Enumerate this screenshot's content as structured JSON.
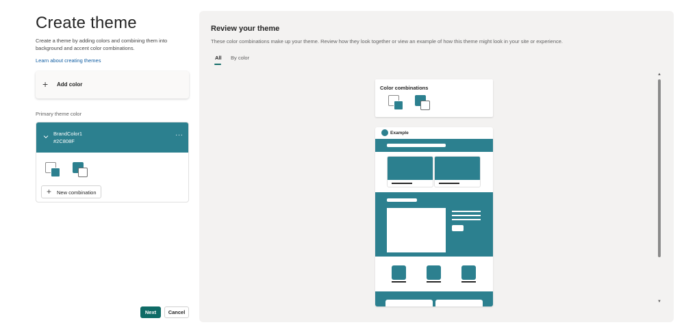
{
  "left": {
    "title": "Create theme",
    "description": "Create a theme by adding colors and combining them into background and accent color combinations.",
    "learn_link": "Learn about creating themes",
    "add_color_label": "Add color",
    "primary_label": "Primary theme color",
    "brand": {
      "name": "BrandColor1",
      "hex": "#2C808F"
    },
    "new_combination_label": "New combination"
  },
  "footer": {
    "next_label": "Next",
    "cancel_label": "Cancel"
  },
  "right": {
    "title": "Review your theme",
    "description": "These color combinations make up your theme. Review how they look together or view an example of how this theme might look in your site or experience.",
    "tabs": [
      {
        "label": "All",
        "selected": true
      },
      {
        "label": "By color",
        "selected": false
      }
    ],
    "color_combinations_label": "Color combinations",
    "example_label": "Example"
  },
  "colors": {
    "brand": "#2C808F",
    "accent_button": "#0F6B66",
    "panel_bg": "#F3F2F1"
  }
}
